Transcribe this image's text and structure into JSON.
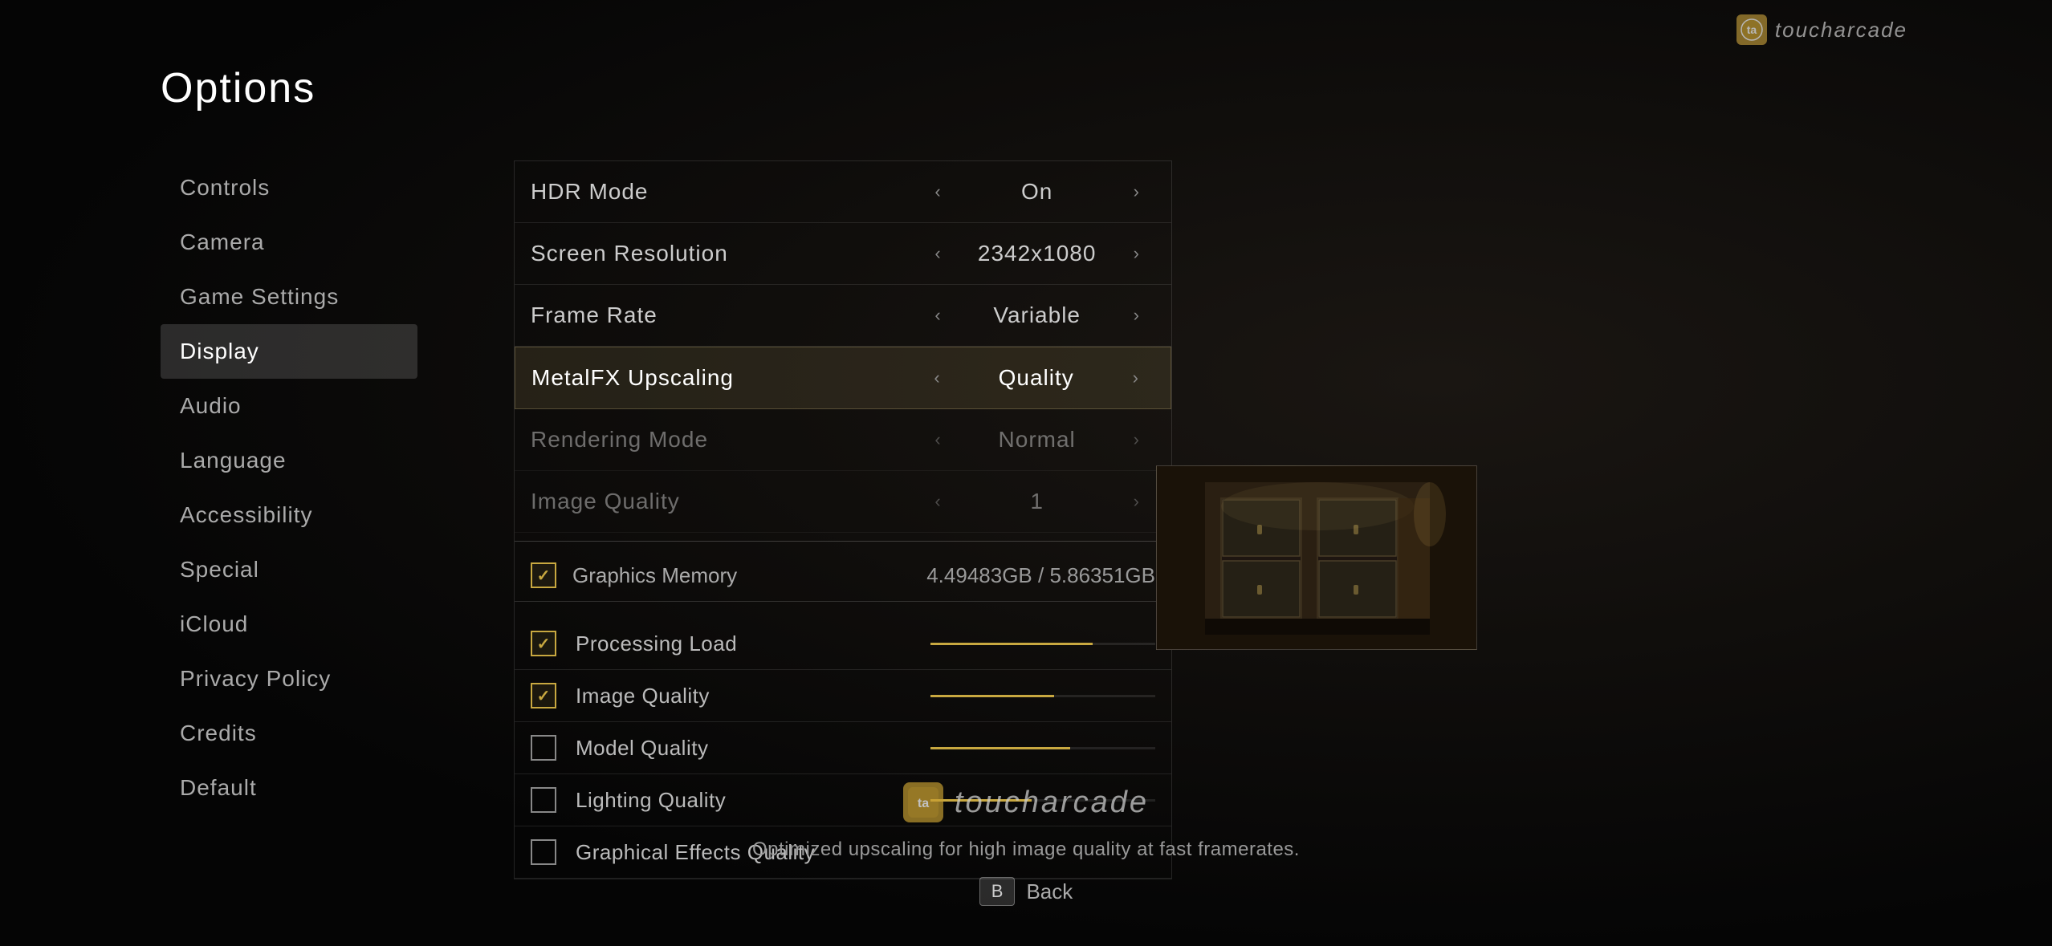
{
  "page": {
    "title": "Options",
    "watermark": {
      "icon_text": "ta",
      "name": "toucharcade"
    }
  },
  "sidebar": {
    "items": [
      {
        "id": "controls",
        "label": "Controls",
        "active": false
      },
      {
        "id": "camera",
        "label": "Camera",
        "active": false
      },
      {
        "id": "game-settings",
        "label": "Game Settings",
        "active": false
      },
      {
        "id": "display",
        "label": "Display",
        "active": true
      },
      {
        "id": "audio",
        "label": "Audio",
        "active": false
      },
      {
        "id": "language",
        "label": "Language",
        "active": false
      },
      {
        "id": "accessibility",
        "label": "Accessibility",
        "active": false
      },
      {
        "id": "special",
        "label": "Special",
        "active": false
      },
      {
        "id": "icloud",
        "label": "iCloud",
        "active": false
      },
      {
        "id": "privacy-policy",
        "label": "Privacy Policy",
        "active": false
      },
      {
        "id": "credits",
        "label": "Credits",
        "active": false
      },
      {
        "id": "default",
        "label": "Default",
        "active": false
      }
    ]
  },
  "settings": {
    "rows": [
      {
        "id": "hdr-mode",
        "label": "HDR Mode",
        "value": "On",
        "dimmed": false,
        "highlighted": false
      },
      {
        "id": "screen-resolution",
        "label": "Screen Resolution",
        "value": "2342x1080",
        "dimmed": false,
        "highlighted": false
      },
      {
        "id": "frame-rate",
        "label": "Frame Rate",
        "value": "Variable",
        "dimmed": false,
        "highlighted": false
      },
      {
        "id": "metalfx-upscaling",
        "label": "MetalFX Upscaling",
        "value": "Quality",
        "dimmed": false,
        "highlighted": true
      },
      {
        "id": "rendering-mode",
        "label": "Rendering Mode",
        "value": "Normal",
        "dimmed": true,
        "highlighted": false
      },
      {
        "id": "image-quality",
        "label": "Image Quality",
        "value": "1",
        "dimmed": true,
        "highlighted": false
      }
    ]
  },
  "graphics_section": {
    "memory_row": {
      "icon_checked": true,
      "label": "Graphics Memory",
      "value": "4.49483GB  /  5.86351GB"
    },
    "checkboxes": [
      {
        "id": "processing-load",
        "label": "Processing Load",
        "checked": true,
        "bar_pct": 72
      },
      {
        "id": "image-quality",
        "label": "Image Quality",
        "checked": true,
        "bar_pct": 55
      },
      {
        "id": "model-quality",
        "label": "Model Quality",
        "checked": false,
        "bar_pct": 62
      },
      {
        "id": "lighting-quality",
        "label": "Lighting Quality",
        "checked": false,
        "bar_pct": 45
      },
      {
        "id": "graphical-effects-quality",
        "label": "Graphical Effects Quality",
        "checked": false,
        "bar_pct": 0
      }
    ]
  },
  "bottom": {
    "description": "Optimized upscaling for high image quality at fast framerates.",
    "back_key": "B",
    "back_label": "Back"
  }
}
